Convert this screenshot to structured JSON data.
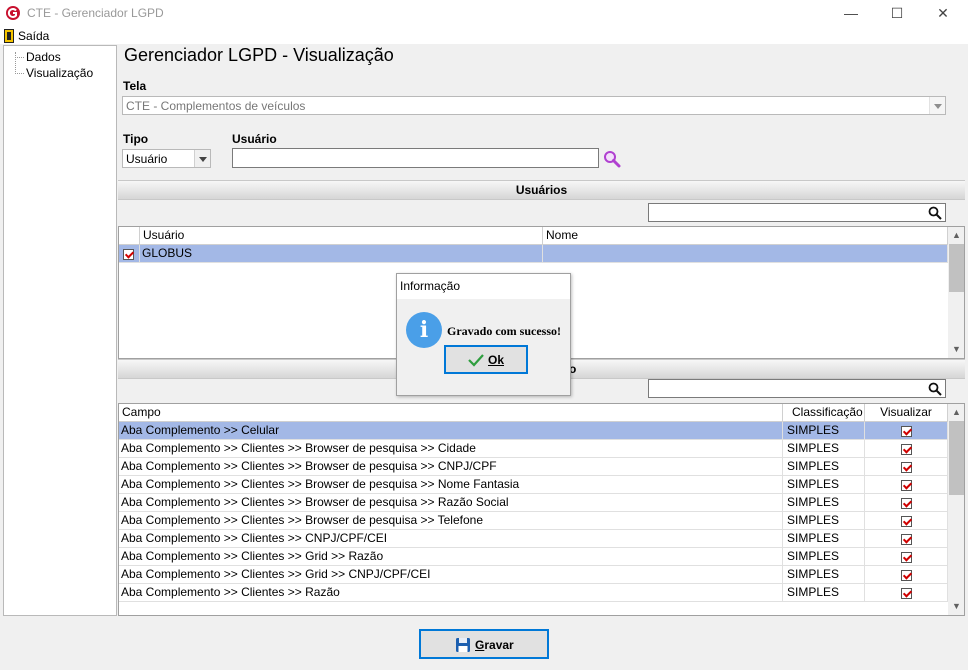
{
  "window": {
    "title": "CTE - Gerenciador LGPD",
    "minimize": "—",
    "maximize": "☐",
    "close": "✕"
  },
  "menu": {
    "exit_label": "Saída"
  },
  "tree": {
    "items": [
      "Dados",
      "Visualização"
    ]
  },
  "page": {
    "title": "Gerenciador LGPD - Visualização"
  },
  "tela": {
    "label": "Tela",
    "value": "CTE - Complementos de veículos"
  },
  "tipo": {
    "label": "Tipo",
    "value": "Usuário"
  },
  "usuario": {
    "label": "Usuário",
    "value": ""
  },
  "usuarios_section": {
    "header": "Usuários",
    "search_value": "",
    "columns": [
      "Usuário",
      "Nome"
    ],
    "rows": [
      {
        "checked": true,
        "usuario": "GLOBUS",
        "nome": ""
      }
    ]
  },
  "campos_section": {
    "header_visible_fragment": "o",
    "search_value": "",
    "columns": [
      "Campo",
      "Classificação",
      "Visualizar"
    ],
    "rows": [
      {
        "campo": "Aba Complemento >> Celular",
        "classificacao": "SIMPLES",
        "visualizar": true
      },
      {
        "campo": "Aba Complemento >> Clientes >> Browser de pesquisa >> Cidade",
        "classificacao": "SIMPLES",
        "visualizar": true
      },
      {
        "campo": "Aba Complemento >> Clientes >> Browser de pesquisa >> CNPJ/CPF",
        "classificacao": "SIMPLES",
        "visualizar": true
      },
      {
        "campo": "Aba Complemento >> Clientes >> Browser de pesquisa >> Nome Fantasia",
        "classificacao": "SIMPLES",
        "visualizar": true
      },
      {
        "campo": "Aba Complemento >> Clientes >> Browser de pesquisa >> Razão Social",
        "classificacao": "SIMPLES",
        "visualizar": true
      },
      {
        "campo": "Aba Complemento >> Clientes >> Browser de pesquisa >> Telefone",
        "classificacao": "SIMPLES",
        "visualizar": true
      },
      {
        "campo": "Aba Complemento >> Clientes >> CNPJ/CPF/CEI",
        "classificacao": "SIMPLES",
        "visualizar": true
      },
      {
        "campo": "Aba Complemento >> Clientes >> Grid >>  Razão",
        "classificacao": "SIMPLES",
        "visualizar": true
      },
      {
        "campo": "Aba Complemento >> Clientes >> Grid >> CNPJ/CPF/CEI",
        "classificacao": "SIMPLES",
        "visualizar": true
      },
      {
        "campo": "Aba Complemento >> Clientes >> Razão",
        "classificacao": "SIMPLES",
        "visualizar": true
      }
    ]
  },
  "dialog": {
    "title": "Informação",
    "message": "Gravado com sucesso!",
    "ok_label": "Ok",
    "icon": "info-icon"
  },
  "footer": {
    "save_label": "Gravar",
    "save_icon": "floppy-disk-icon"
  },
  "colors": {
    "selection": "#a3b8e6",
    "focus_border": "#0078d7",
    "check_red": "#d00000",
    "info_blue": "#4a9fe8",
    "search_icon_purple": "#b040d0"
  }
}
